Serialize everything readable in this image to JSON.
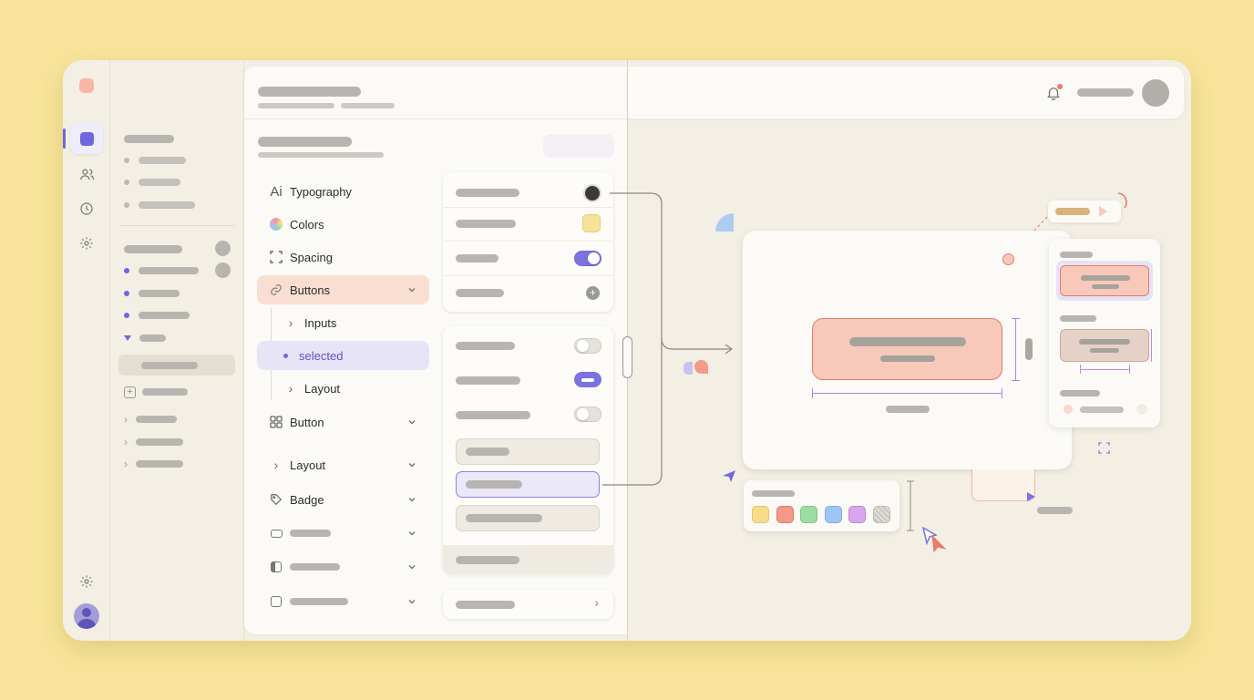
{
  "colors": {
    "accent": "#6f66e0",
    "coral": "#e5796b",
    "peach": "#f8c9ba",
    "background": "#f8e59b"
  },
  "rail": {
    "icons": [
      "app-square-icon",
      "users-icon",
      "clock-icon",
      "settings-icon",
      "settings-icon",
      "user-avatar"
    ]
  },
  "menu": {
    "items": [
      {
        "label": "Typography",
        "icon": "Ai"
      },
      {
        "label": "Colors",
        "icon": "color-wheel-icon"
      },
      {
        "label": "Spacing",
        "icon": "spacing-icon"
      },
      {
        "label": "Buttons",
        "icon": "link-icon"
      },
      {
        "label": "Inputs",
        "icon": "chevron-right-icon"
      },
      {
        "label": "selected",
        "icon": "dot-icon"
      },
      {
        "label": "Layout",
        "icon": "chevron-right-icon"
      },
      {
        "label": "Button",
        "icon": "grid-icon"
      },
      {
        "label": "Layout",
        "icon": "chevron-right-icon"
      },
      {
        "label": "Badge",
        "icon": "tag-icon"
      }
    ]
  },
  "swatches": [
    "#f8dc8a",
    "#f39a8a",
    "#9ddca2",
    "#9ec6f2",
    "#d8a6ec",
    "#dedbd5"
  ]
}
